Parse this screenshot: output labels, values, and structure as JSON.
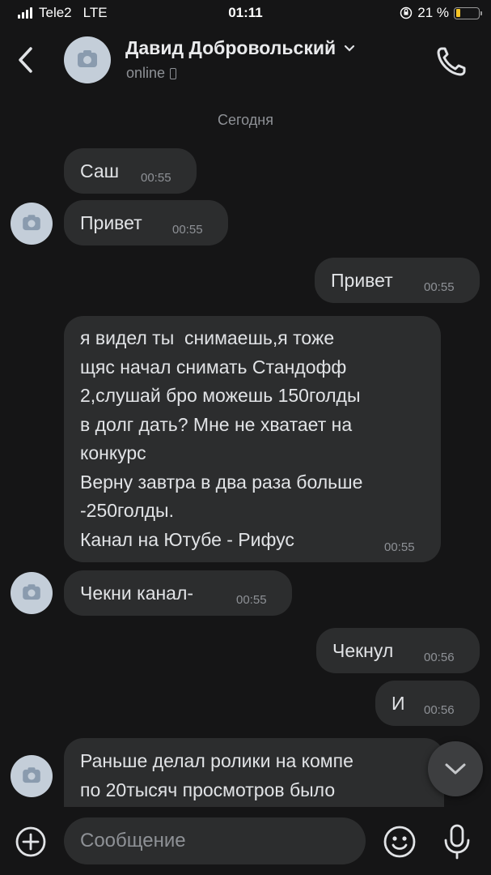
{
  "status_bar": {
    "carrier": "Tele2",
    "network": "LTE",
    "time": "01:11",
    "battery": "21 %",
    "battery_level": 0.21
  },
  "header": {
    "name": "Давид Добровольский",
    "status": "online"
  },
  "date_separator": "Сегодня",
  "messages": [
    {
      "text": "Саш",
      "time": "00:55"
    },
    {
      "text": "Привет",
      "time": "00:55"
    },
    {
      "text": "Привет",
      "time": "00:55"
    },
    {
      "text": "я видел ты  снимаешь,я тоже\nщяс начал снимать Стандофф\n2,слушай бро можешь 150голды\nв долг дать? Мне не хватает на\nконкурс\nВерну завтра в два раза больше\n-250голды.\nКанал на Ютубе - Рифус",
      "time": "00:55"
    },
    {
      "text": "Чекни канал-",
      "time": "00:55"
    },
    {
      "text": "Чекнул",
      "time": "00:56"
    },
    {
      "text": "И",
      "time": "00:56"
    },
    {
      "text": "Раньше делал ролики на компе\nпо 20тысяч просмотров было",
      "time": ""
    }
  ],
  "composer": {
    "placeholder": "Сообщение"
  },
  "colors": {
    "background": "#151516",
    "bubble": "#2c2d2e",
    "muted": "#8e9196",
    "battery": "#f5c425"
  },
  "icons": [
    "back-chevron-icon",
    "camera-placeholder-icon",
    "chevron-down-icon",
    "phone-icon",
    "scroll-down-icon",
    "add-circle-icon",
    "emoji-icon",
    "microphone-icon"
  ]
}
